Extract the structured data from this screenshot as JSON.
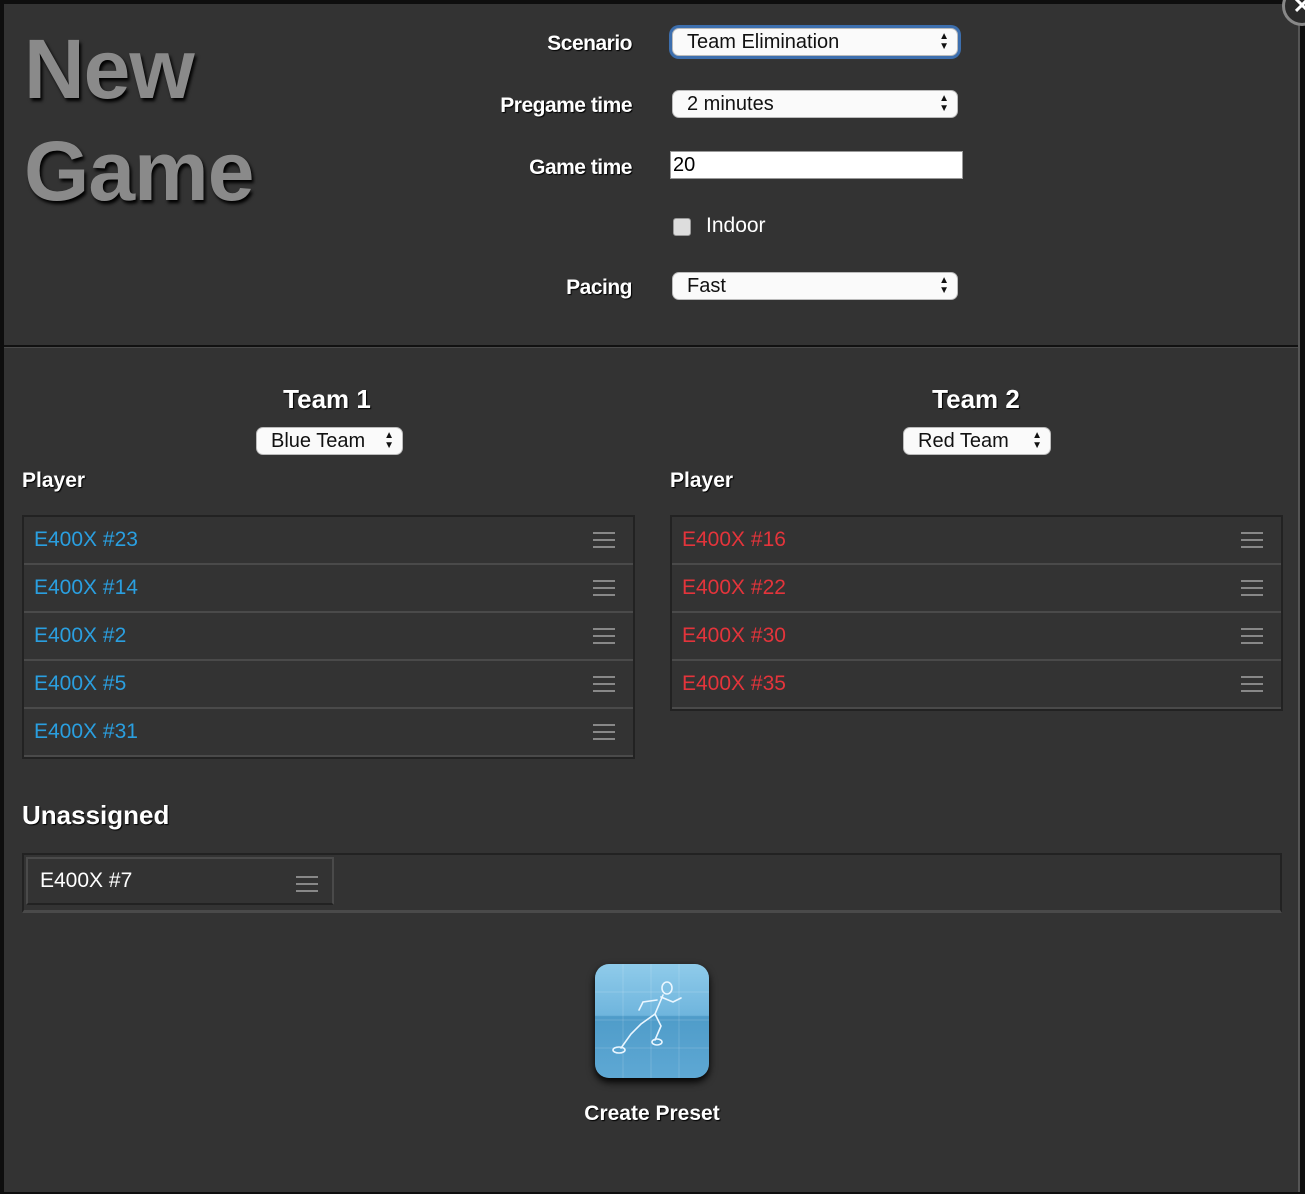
{
  "dialog": {
    "title_line1": "New",
    "title_line2": "Game",
    "close_icon": "✕"
  },
  "form": {
    "scenario_label": "Scenario",
    "scenario_value": "Team Elimination",
    "pregame_label": "Pregame time",
    "pregame_value": "2 minutes",
    "gametime_label": "Game time",
    "gametime_value": "20",
    "indoor_label": "Indoor",
    "indoor_checked": false,
    "pacing_label": "Pacing",
    "pacing_value": "Fast"
  },
  "team1": {
    "heading": "Team 1",
    "team_value": "Blue Team",
    "column_header": "Player",
    "color": "#2a9fe0",
    "players": [
      "E400X #23",
      "E400X #14",
      "E400X #2",
      "E400X #5",
      "E400X #31"
    ]
  },
  "team2": {
    "heading": "Team 2",
    "team_value": "Red Team",
    "column_header": "Player",
    "color": "#e4343b",
    "players": [
      "E400X #16",
      "E400X #22",
      "E400X #30",
      "E400X #35"
    ]
  },
  "unassigned": {
    "heading": "Unassigned",
    "players": [
      "E400X #7"
    ]
  },
  "preset": {
    "label": "Create Preset",
    "icon": "running-figure-icon"
  }
}
